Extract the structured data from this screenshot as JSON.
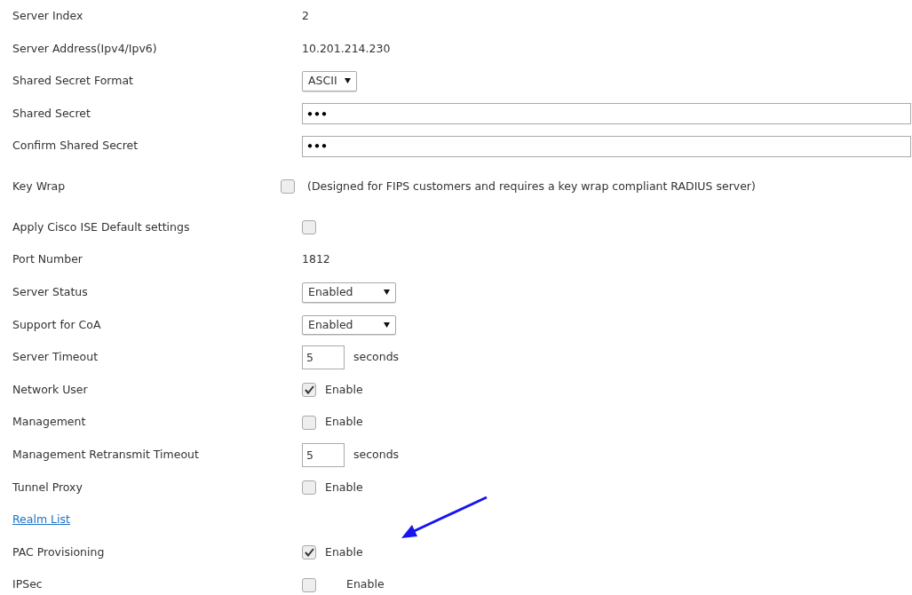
{
  "fields": [
    {
      "label": "Server Index",
      "kind": "text",
      "value": "2"
    },
    {
      "label": "Server Address(Ipv4/Ipv6)",
      "kind": "text",
      "value": "10.201.214.230"
    },
    {
      "label": "Shared Secret Format",
      "kind": "select",
      "value": "ASCII"
    },
    {
      "label": "Shared Secret",
      "kind": "password",
      "value": "•••"
    },
    {
      "label": "Confirm Shared Secret",
      "kind": "password",
      "value": "•••"
    },
    {
      "label": "Key Wrap",
      "kind": "checkbox",
      "checked": false,
      "note": "(Designed for FIPS customers and requires a key wrap compliant RADIUS server)"
    },
    {
      "label": "Apply Cisco ISE Default settings",
      "kind": "checkbox",
      "checked": false
    },
    {
      "label": "Port Number",
      "kind": "text",
      "value": "1812"
    },
    {
      "label": "Server Status",
      "kind": "select",
      "value": "Enabled"
    },
    {
      "label": "Support for CoA",
      "kind": "select",
      "value": "Enabled"
    },
    {
      "label": "Server Timeout",
      "kind": "number",
      "value": "5",
      "unit": "seconds"
    },
    {
      "label": "Network User",
      "kind": "checkbox",
      "checked": true,
      "note": "Enable"
    },
    {
      "label": "Management",
      "kind": "checkbox",
      "checked": false,
      "note": "Enable"
    },
    {
      "label": "Management Retransmit Timeout",
      "kind": "number",
      "value": "5",
      "unit": "seconds"
    },
    {
      "label": "Tunnel Proxy",
      "kind": "checkbox",
      "checked": false,
      "note": "Enable"
    },
    {
      "label": "Realm List",
      "kind": "link"
    },
    {
      "label": "PAC Provisioning",
      "kind": "checkbox",
      "checked": true,
      "note": "Enable"
    },
    {
      "label": "IPSec",
      "kind": "checkbox",
      "checked": false,
      "note": "Enable"
    }
  ]
}
